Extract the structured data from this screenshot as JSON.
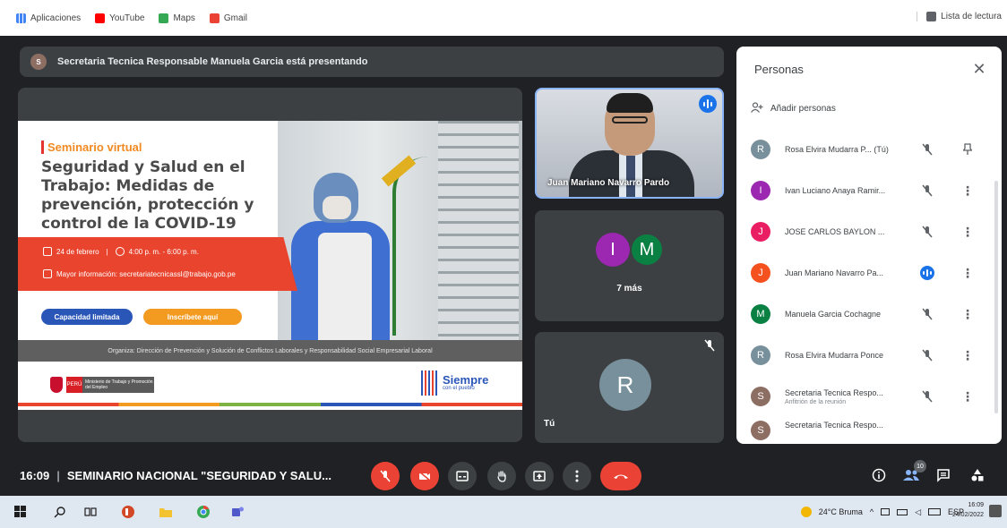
{
  "bookmarks": {
    "items": [
      {
        "label": "Aplicaciones",
        "icon": "apps-grid-icon",
        "color": "#4285f4"
      },
      {
        "label": "YouTube",
        "icon": "youtube-icon",
        "color": "#ff0000"
      },
      {
        "label": "Maps",
        "icon": "maps-icon",
        "color": "#34a853"
      },
      {
        "label": "Gmail",
        "icon": "gmail-icon",
        "color": "#ea4335"
      }
    ],
    "reading_list": "Lista de lectura"
  },
  "presenting_banner": "Secretaria Tecnica Responsable Manuela Garcia está presentando",
  "slide": {
    "kicker": "Seminario virtual",
    "title": "Seguridad y Salud en el Trabajo: Medidas de prevención, protección y control de la COVID-19",
    "date": "24 de febrero",
    "time": "4:00 p. m. - 6:00 p. m.",
    "info": "Mayor información: secretariatecnicassl@trabajo.gob.pe",
    "capacity_pill": "Capacidad limitada",
    "register_pill": "Inscríbete aquí",
    "organizer": "Organiza: Dirección de Prevención y Solución de Conflictos Laborales y Responsabilidad Social Empresarial Laboral",
    "peru_label": "PERÚ",
    "ministry_label": "Ministerio de Trabajo y Promoción del Empleo",
    "siempre": "Siempre",
    "siempre_sub": "con el pueblo"
  },
  "tiles": {
    "video_name": "Juan Mariano Navarro Pardo",
    "more_avatars": [
      "I",
      "M"
    ],
    "more_label": "7 más",
    "me_initial": "R",
    "me_label": "Tú"
  },
  "bottom_bar": {
    "time": "16:09",
    "meeting_title": "SEMINARIO NACIONAL \"SEGURIDAD Y SALU...",
    "people_count": "10"
  },
  "people_panel": {
    "title": "Personas",
    "add_label": "Añadir personas",
    "participants": [
      {
        "initial": "R",
        "name": "Rosa Elvira Mudarra P... (Tú)",
        "sub": "",
        "color": "#78909c",
        "mic": "muted",
        "action": "pin"
      },
      {
        "initial": "I",
        "name": "Ivan Luciano Anaya Ramir...",
        "sub": "",
        "color": "#9c27b0",
        "mic": "muted",
        "action": "more"
      },
      {
        "initial": "J",
        "name": "JOSE CARLOS BAYLON ...",
        "sub": "",
        "color": "#e91e63",
        "mic": "muted",
        "action": "more"
      },
      {
        "initial": "J",
        "name": "Juan Mariano Navarro Pa...",
        "sub": "",
        "color": "#f4511e",
        "mic": "speaking",
        "action": "more"
      },
      {
        "initial": "M",
        "name": "Manuela Garcia Cochagne",
        "sub": "",
        "color": "#0b8043",
        "mic": "muted",
        "action": "more"
      },
      {
        "initial": "R",
        "name": "Rosa Elvira Mudarra Ponce",
        "sub": "",
        "color": "#78909c",
        "mic": "muted",
        "action": "more"
      },
      {
        "initial": "S",
        "name": "Secretaria Tecnica Respo...",
        "sub": "Anfitrión de la reunión",
        "color": "#8d6e63",
        "mic": "muted",
        "action": "more"
      },
      {
        "initial": "S",
        "name": "Secretaria Tecnica Respo...",
        "sub": "",
        "color": "#8d6e63",
        "mic": "muted",
        "action": "more"
      }
    ]
  },
  "taskbar": {
    "weather": "24°C Bruma",
    "lang": "ESP",
    "clock_time": "16:09",
    "clock_date": "24/02/2022"
  }
}
